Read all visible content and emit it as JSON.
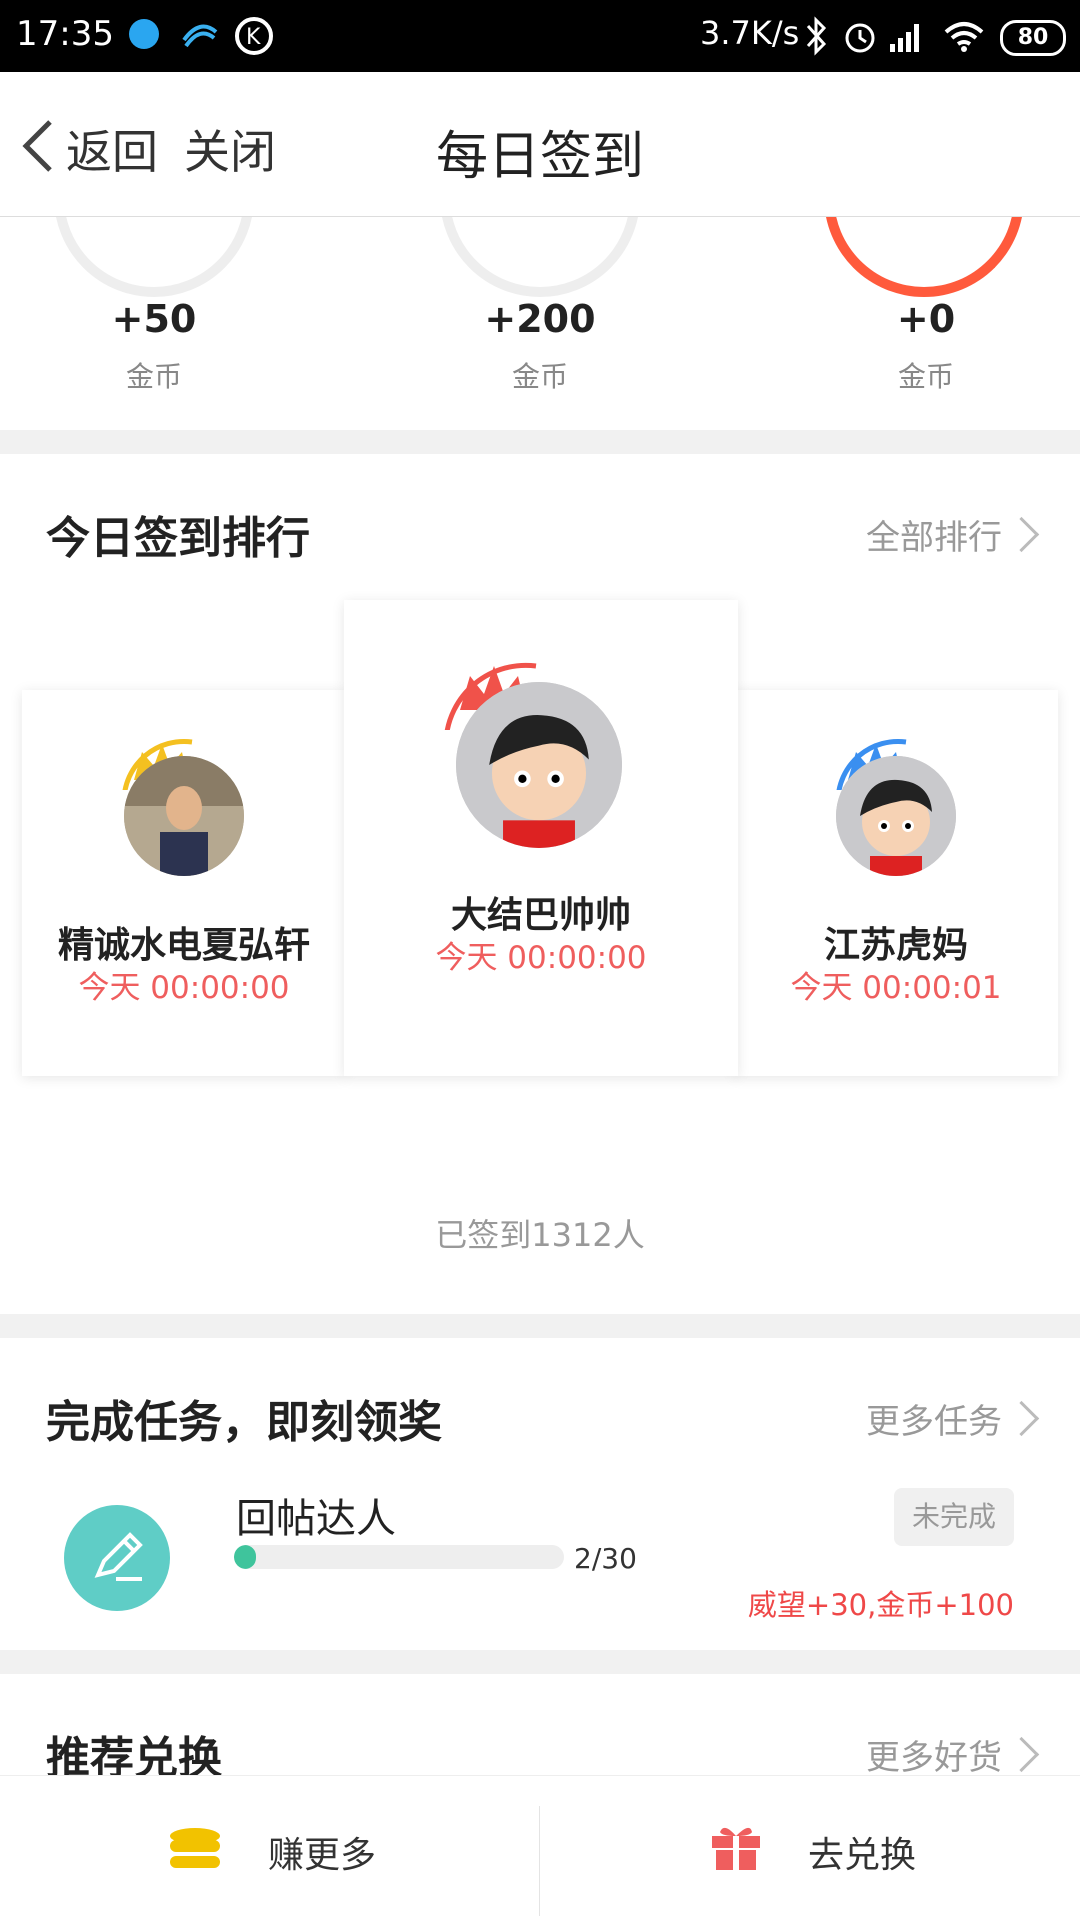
{
  "status_bar": {
    "time": "17:35",
    "speed": "3.7K/s",
    "battery": "80"
  },
  "nav": {
    "back_label": "返回",
    "close_label": "关闭",
    "title": "每日签到"
  },
  "coins": [
    {
      "value": "+50",
      "unit": "金币"
    },
    {
      "value": "+200",
      "unit": "金币"
    },
    {
      "value": "+0",
      "unit": "金币"
    }
  ],
  "ranking": {
    "title": "今日签到排行",
    "more_label": "全部排行",
    "first": {
      "name": "大结巴帅帅",
      "time": "今天 00:00:00",
      "crown_color": "#f0524a"
    },
    "second": {
      "name": "精诚水电夏弘轩",
      "time": "今天 00:00:00",
      "crown_color": "#f4c020"
    },
    "third": {
      "name": "江苏虎妈",
      "time": "今天 00:00:01",
      "crown_color": "#3a8ff0"
    },
    "total_signed": "已签到1312人"
  },
  "tasks": {
    "title": "完成任务，即刻领奖",
    "more_label": "更多任务",
    "items": [
      {
        "name": "回帖达人",
        "progress_text": "2/30",
        "progress": 0.067,
        "status": "未完成",
        "reward": "威望+30,金币+100"
      }
    ]
  },
  "exchange": {
    "title": "推荐兑换",
    "more_label": "更多好货"
  },
  "bottom_bar": {
    "earn_label": "赚更多",
    "exchange_label": "去兑换"
  },
  "colors": {
    "accent_red": "#ef5e5e",
    "progress_green": "#3fc49c",
    "task_icon_teal": "#5fcdc6",
    "coin_yellow": "#f2c200",
    "gift_red": "#ef5e5e"
  }
}
